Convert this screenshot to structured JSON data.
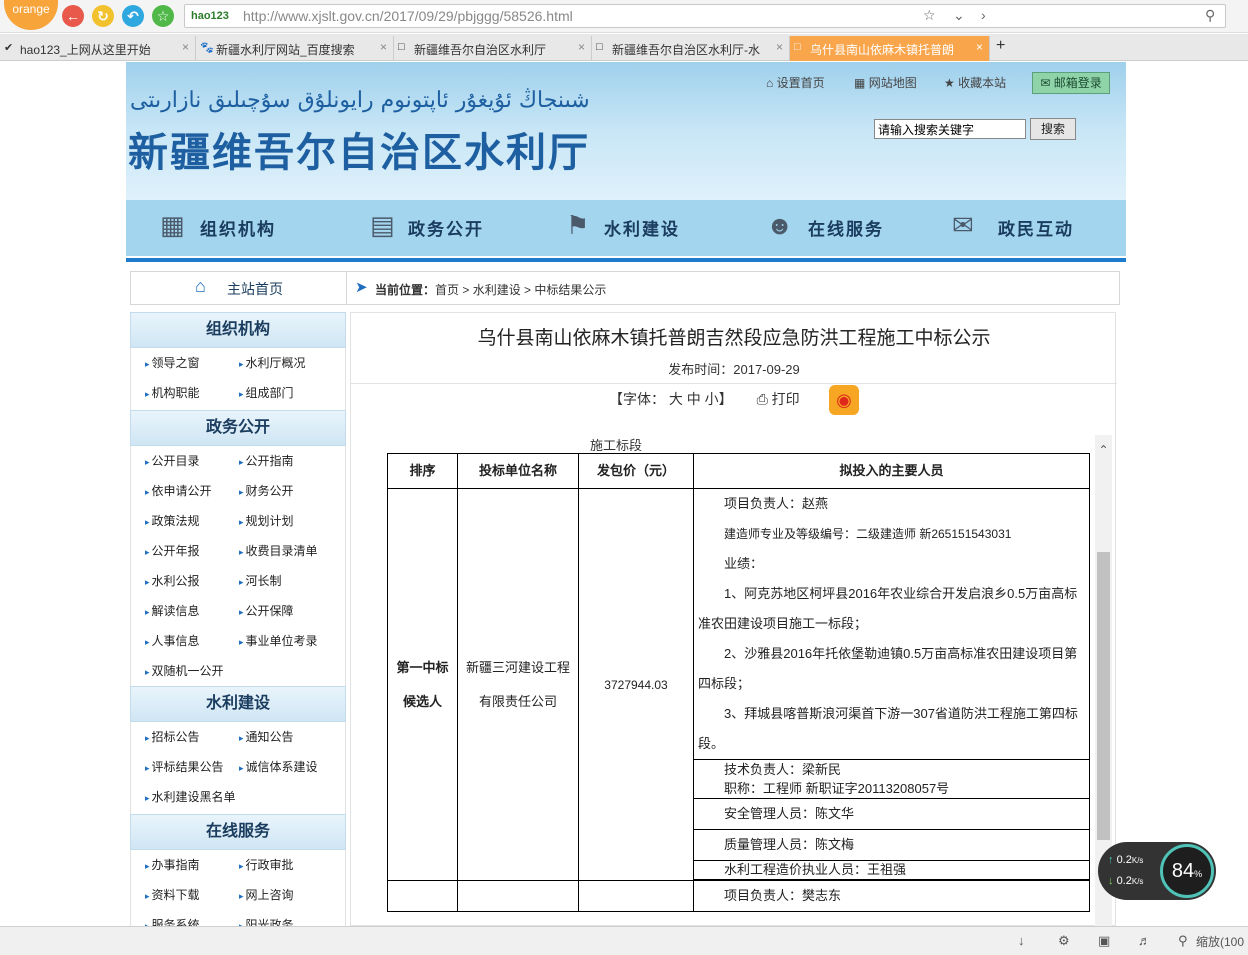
{
  "browser": {
    "badge": "orange",
    "url_logo": "hao123",
    "url": "http://www.xjslt.gov.cn/2017/09/29/pbjggg/58526.html",
    "tabs": [
      {
        "label": "hao123_上网从这里开始"
      },
      {
        "label": "新疆水利厅网站_百度搜索"
      },
      {
        "label": "新疆维吾尔自治区水利厅"
      },
      {
        "label": "新疆维吾尔自治区水利厅-水"
      },
      {
        "label": "乌什县南山依麻木镇托普朗"
      }
    ],
    "new_tab": "+"
  },
  "header": {
    "uyghur_title": "شىنجاڭ ئۇيغۇر ئاپتونوم رايونلۇق سۇچىلىق نازارىتى",
    "site_title": "新疆维吾尔自治区水利厅",
    "links": [
      "设置首页",
      "网站地图",
      "收藏本站"
    ],
    "mail": "邮箱登录",
    "search_placeholder": "请输入搜索关键字",
    "search_button": "搜索"
  },
  "nav": [
    "组织机构",
    "政务公开",
    "水利建设",
    "在线服务",
    "政民互动"
  ],
  "crumb": {
    "home": "主站首页",
    "label": "当前位置：",
    "path": "首页 > 水利建设 > 中标结果公示"
  },
  "sidebar": [
    {
      "title": "组织机构",
      "items": [
        "领导之窗",
        "水利厅概况",
        "机构职能",
        "组成部门"
      ]
    },
    {
      "title": "政务公开",
      "items": [
        "公开目录",
        "公开指南",
        "依申请公开",
        "财务公开",
        "政策法规",
        "规划计划",
        "公开年报",
        "收费目录清单",
        "水利公报",
        "河长制",
        "解读信息",
        "公开保障",
        "人事信息",
        "事业单位考录",
        "双随机一公开"
      ]
    },
    {
      "title": "水利建设",
      "items": [
        "招标公告",
        "通知公告",
        "评标结果公告",
        "诚信体系建设",
        "水利建设黑名单"
      ]
    },
    {
      "title": "在线服务",
      "items": [
        "办事指南",
        "行政审批",
        "资料下载",
        "网上咨询",
        "服务系统",
        "阳光政务"
      ]
    }
  ],
  "article": {
    "title": "乌什县南山依麻木镇托普朗吉然段应急防洪工程施工中标公示",
    "published": "发布时间：2017-09-29",
    "font_tools": "【字体： 大  中  小】",
    "print": "打印",
    "section_cut": "施工标段"
  },
  "table": {
    "headers": [
      "排序",
      "投标单位名称",
      "发包价（元）",
      "拟投入的主要人员"
    ],
    "row": {
      "rank": "第一中标候选人",
      "company": "新疆三河建设工程有限责任公司",
      "price": "3727944.03",
      "lines": [
        "项目负责人：赵燕",
        "建造师专业及等级编号：二级建造师  新265151543031",
        "业绩：",
        "1、阿克苏地区柯坪县2016年农业综合开发启浪乡0.5万亩高标准农田建设项目施工一标段；",
        "2、沙雅县2016年托依堡勒迪镇0.5万亩高标准农田建设项目第四标段；",
        "3、拜城县喀普斯浪河渠首下游一307省道防洪工程施工第四标段。"
      ],
      "tech": "技术负责人：梁新民",
      "title_cert": "职称：工程师 新职证字20113208057号",
      "safety": "安全管理人员：陈文华",
      "quality": "质量管理人员：陈文梅",
      "cost": "水利工程造价执业人员：王祖强"
    },
    "next_row": "项目负责人：樊志东"
  },
  "widget": {
    "up": "0.2",
    "down": "0.2",
    "unit": "K/s",
    "percent": "84",
    "pct_sign": "%"
  },
  "status": {
    "zoom": "缩放(100"
  }
}
